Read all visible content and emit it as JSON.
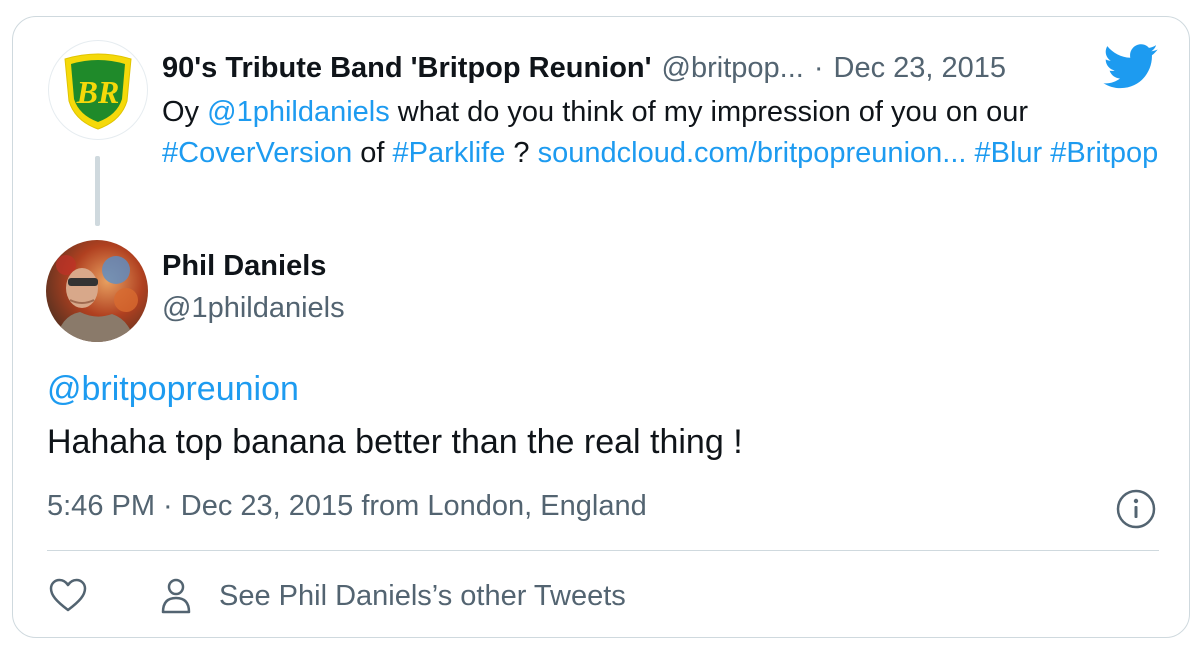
{
  "quoted_tweet": {
    "author_name": "90's Tribute Band 'Britpop Reunion'",
    "author_handle": "@britpop...",
    "separator": "·",
    "date": "Dec 23, 2015",
    "avatar_text": "BR",
    "text_parts": [
      {
        "t": "Oy ",
        "kind": "plain"
      },
      {
        "t": "@1phildaniels",
        "kind": "link"
      },
      {
        "t": " what do you think of my impression of you on our ",
        "kind": "plain"
      },
      {
        "t": "#CoverVersion",
        "kind": "link"
      },
      {
        "t": " of ",
        "kind": "plain"
      },
      {
        "t": "#Parklife",
        "kind": "link"
      },
      {
        "t": " ? ",
        "kind": "plain"
      },
      {
        "t": "soundcloud.com/britpopreunion...",
        "kind": "link"
      },
      {
        "t": " ",
        "kind": "plain"
      },
      {
        "t": "#Blur",
        "kind": "link"
      },
      {
        "t": " ",
        "kind": "plain"
      },
      {
        "t": "#Britpop",
        "kind": "link"
      }
    ]
  },
  "tweet": {
    "author_name": "Phil Daniels",
    "author_handle": "@1phildaniels",
    "mention": "@britpopreunion",
    "text": "Hahaha top banana better than the real thing !",
    "meta": "5:46 PM · Dec 23, 2015 from London, England"
  },
  "actions": {
    "other_tweets_label": "See Phil Daniels’s other Tweets"
  },
  "icons": {
    "brand": "twitter-bird-icon",
    "like": "heart-icon",
    "profile": "user-icon",
    "info": "info-icon"
  },
  "colors": {
    "link": "#1d9bf0",
    "secondary": "#536471",
    "primary_text": "#0f1419",
    "border": "#cfd9de",
    "br_green": "#1f8a2a",
    "br_yellow": "#f5d90a"
  }
}
